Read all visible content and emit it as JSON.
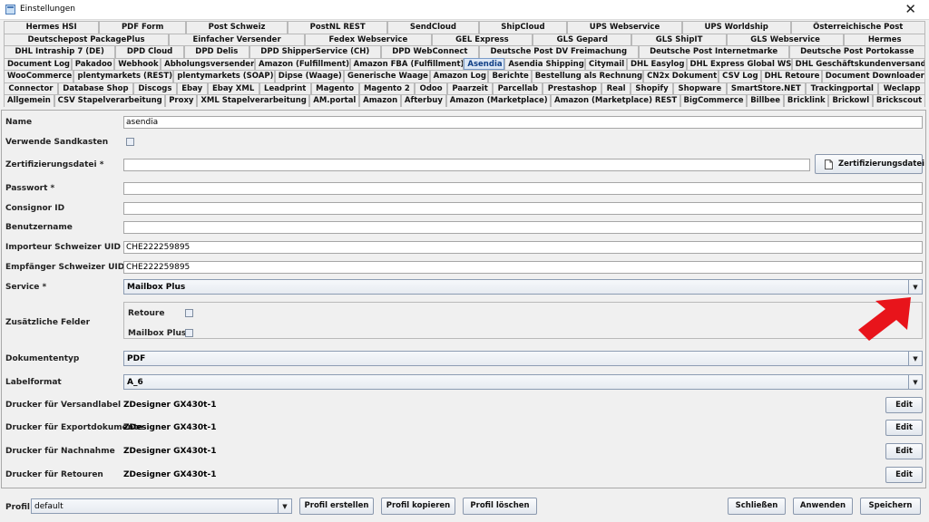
{
  "window": {
    "title": "Einstellungen"
  },
  "tabs": {
    "rows": [
      [
        "Hermes HSI",
        "PDF Form",
        "Post Schweiz",
        "PostNL REST",
        "SendCloud",
        "ShipCloud",
        "UPS Webservice",
        "UPS Worldship",
        "Österreichische Post"
      ],
      [
        "Deutschepost PackagePlus",
        "Einfacher Versender",
        "Fedex Webservice",
        "GEL Express",
        "GLS Gepard",
        "GLS ShipIT",
        "GLS Webservice",
        "Hermes"
      ],
      [
        "DHL Intraship 7 (DE)",
        "DPD Cloud",
        "DPD Delis",
        "DPD ShipperService (CH)",
        "DPD WebConnect",
        "Deutsche Post DV Freimachung",
        "Deutsche Post Internetmarke",
        "Deutsche Post Portokasse"
      ],
      [
        "Document Log",
        "Pakadoo",
        "Webhook",
        "Abholungsversender",
        "Amazon (Fulfillment)",
        "Amazon FBA (Fulfillment)",
        "Asendia",
        "Asendia Shipping",
        "Citymail",
        "DHL Easylog",
        "DHL Express Global WS",
        "DHL Geschäftskundenversand"
      ],
      [
        "WooCommerce",
        "plentymarkets (REST)",
        "plentymarkets (SOAP)",
        "Dipse (Waage)",
        "Generische Waage",
        "Amazon Log",
        "Berichte",
        "Bestellung als Rechnung",
        "CN2x Dokument",
        "CSV Log",
        "DHL Retoure",
        "Document Downloader"
      ],
      [
        "Connector",
        "Database Shop",
        "Discogs",
        "Ebay",
        "Ebay XML",
        "Leadprint",
        "Magento",
        "Magento 2",
        "Odoo",
        "Paarzeit",
        "Parcellab",
        "Prestashop",
        "Real",
        "Shopify",
        "Shopware",
        "SmartStore.NET",
        "Trackingportal",
        "Weclapp"
      ],
      [
        "Allgemein",
        "CSV Stapelverarbeitung",
        "Proxy",
        "XML Stapelverarbeitung",
        "AM.portal",
        "Amazon",
        "Afterbuy",
        "Amazon (Marketplace)",
        "Amazon (Marketplace) REST",
        "BigCommerce",
        "Billbee",
        "Bricklink",
        "Brickowl",
        "Brickscout"
      ]
    ],
    "active": "Asendia"
  },
  "form": {
    "name": {
      "label": "Name",
      "value": "asendia"
    },
    "sandbox": {
      "label": "Verwende Sandkasten"
    },
    "cert": {
      "label": "Zertifizierungsdatei *",
      "value": "",
      "button": "Zertifizierungsdatei"
    },
    "password": {
      "label": "Passwort *",
      "value": ""
    },
    "consignor": {
      "label": "Consignor ID",
      "value": ""
    },
    "username": {
      "label": "Benutzername",
      "value": ""
    },
    "importer_uid": {
      "label": "Importeur Schweizer UID *",
      "value": "CHE222259895"
    },
    "recipient_uid": {
      "label": "Empfänger Schweizer UID *",
      "value": "CHE222259895"
    },
    "service": {
      "label": "Service *",
      "value": "Mailbox Plus"
    },
    "extras": {
      "label": "Zusätzliche Felder",
      "retoure": "Retoure",
      "mailbox_plus": "Mailbox Plus"
    },
    "doctype": {
      "label": "Dokumententyp",
      "value": "PDF"
    },
    "labelformat": {
      "label": "Labelformat",
      "value": "A_6"
    },
    "printers": [
      {
        "label": "Drucker für Versandlabel",
        "value": "ZDesigner GX430t-1",
        "button": "Edit"
      },
      {
        "label": "Drucker für Exportdokumente",
        "value": "ZDesigner GX430t-1",
        "button": "Edit"
      },
      {
        "label": "Drucker für Nachnahme",
        "value": "ZDesigner GX430t-1",
        "button": "Edit"
      },
      {
        "label": "Drucker für Retouren",
        "value": "ZDesigner GX430t-1",
        "button": "Edit"
      }
    ]
  },
  "bottom": {
    "profile_label": "Profil",
    "profile_value": "default",
    "create": "Profil erstellen",
    "copy": "Profil kopieren",
    "delete": "Profil löschen",
    "close": "Schließen",
    "apply": "Anwenden",
    "save": "Speichern"
  },
  "colors": {
    "arrow": "#e8141b",
    "active_tab": "#dce7f5"
  }
}
